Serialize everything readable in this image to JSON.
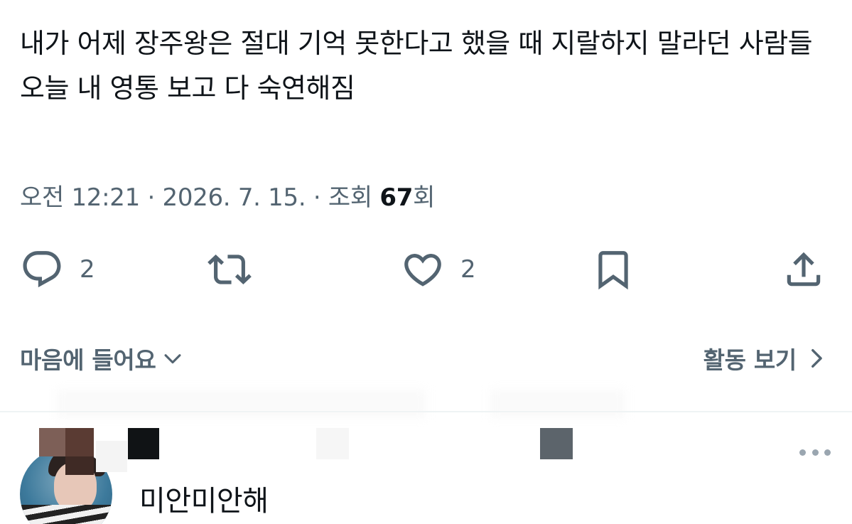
{
  "tweet": {
    "text": "내가 어제 장주왕은 절대 기억 못한다고 했을 때 지랄하지 말라던 사람들 오늘 내 영통 보고 다 숙연해짐",
    "time": "오전 12:21",
    "date": "2026. 7. 15.",
    "views_prefix": "조회",
    "views_count": "67",
    "views_suffix": "회"
  },
  "actions": {
    "reply_count": "2",
    "like_count": "2"
  },
  "footer": {
    "likes_label": "마음에 들어요",
    "activity_label": "활동 보기"
  },
  "reply": {
    "name": "미안미안해"
  },
  "colors": {
    "text_primary": "#0f1419",
    "text_secondary": "#536471",
    "divider": "#eff3f4"
  },
  "icons": [
    "reply-icon",
    "retweet-icon",
    "heart-icon",
    "bookmark-icon",
    "share-icon",
    "chevron-down-icon",
    "chevron-right-icon",
    "more-icon"
  ]
}
